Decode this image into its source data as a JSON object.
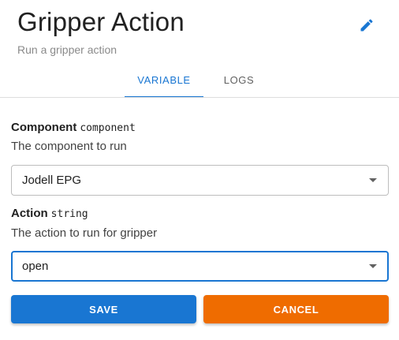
{
  "dialog": {
    "title": "Gripper Action",
    "subtitle": "Run a gripper action",
    "edit_icon": "pencil-icon",
    "accent_color": "#1976d2",
    "cancel_color": "#ef6c00"
  },
  "tabs": [
    {
      "label": "VARIABLE",
      "active": true
    },
    {
      "label": "LOGS",
      "active": false
    }
  ],
  "fields": [
    {
      "label": "Component",
      "type": "component",
      "description": "The component to run",
      "value": "Jodell EPG"
    },
    {
      "label": "Action",
      "type": "string",
      "description": "The action to run for gripper",
      "value": "open"
    }
  ],
  "actions": {
    "save_label": "SAVE",
    "cancel_label": "CANCEL"
  }
}
